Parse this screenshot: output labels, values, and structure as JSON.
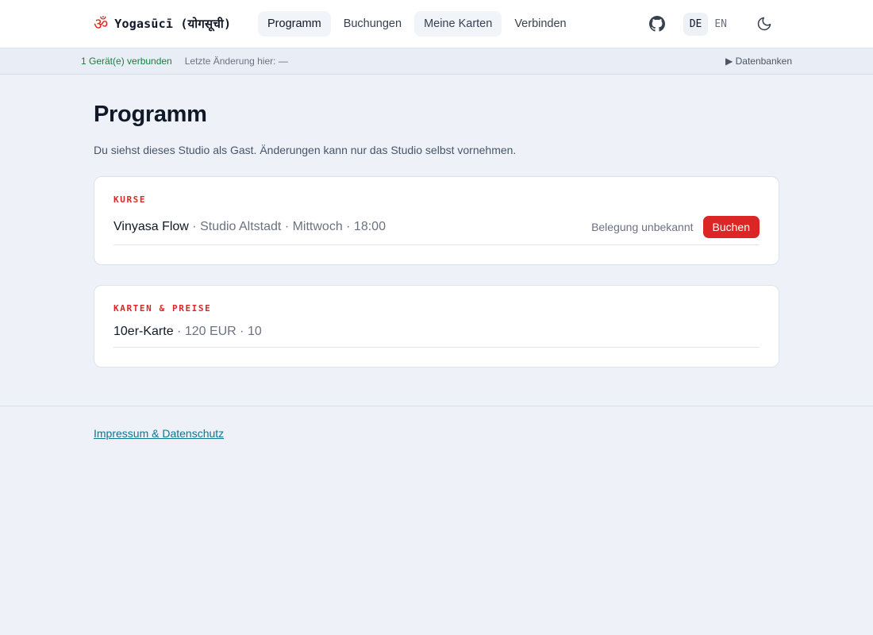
{
  "header": {
    "brand_icon": "ॐ",
    "brand_title": "Yogasūcī (योगसूची)",
    "nav": [
      {
        "label": "Programm"
      },
      {
        "label": "Buchungen"
      },
      {
        "label": "Meine Karten"
      },
      {
        "label": "Verbinden"
      }
    ],
    "icons": {
      "github": "github-icon",
      "theme": "moon-icon"
    },
    "languages": [
      {
        "label": "DE"
      },
      {
        "label": "EN"
      }
    ]
  },
  "status": {
    "connected": "1 Gerät(e) verbunden",
    "last_change": "Letzte Änderung hier: —",
    "databases": "▶ Datenbanken"
  },
  "main": {
    "title": "Programm",
    "intro": "Du siehst dieses Studio als Gast. Änderungen kann nur das Studio selbst vornehmen.",
    "courses": {
      "label": "KURSE",
      "items": [
        {
          "name": "Vinyasa Flow",
          "details": " · Studio Altstadt · Mittwoch · 18:00",
          "occupancy": "Belegung unbekannt",
          "button": "Buchen"
        }
      ]
    },
    "prices": {
      "label": "KARTEN & PREISE",
      "items": [
        {
          "name": "10er-Karte",
          "details": " · 120 EUR · 10"
        }
      ]
    }
  },
  "footer": {
    "link": "Impressum & Datenschutz"
  },
  "colors": {
    "accent": "#dc2626",
    "connected": "#15803d",
    "link": "#0e7490"
  }
}
